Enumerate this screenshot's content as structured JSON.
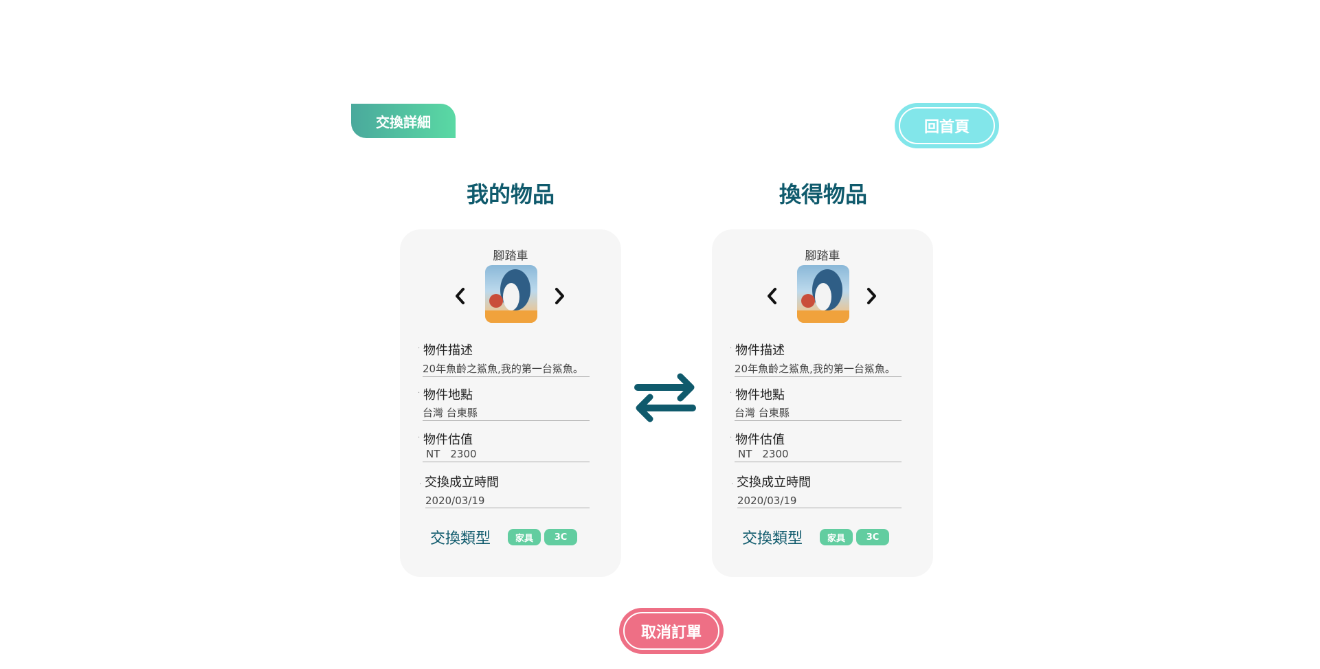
{
  "header": {
    "section_tag": "交換詳細",
    "home_button": "回首頁"
  },
  "columns": [
    {
      "title": "我的物品",
      "item_name": "腳踏車",
      "fields": {
        "description_label": "物件描述",
        "description": "20年魚齡之鯊魚,我的第一台鯊魚。",
        "location_label": "物件地點",
        "location": "台灣 台東縣",
        "value_label": "物件估值",
        "value": "NT　2300",
        "time_label": "交換成立時間",
        "time": "2020/03/19"
      },
      "type_label": "交換類型",
      "types": [
        "家具",
        "3C"
      ]
    },
    {
      "title": "換得物品",
      "item_name": "腳踏車",
      "fields": {
        "description_label": "物件描述",
        "description": "20年魚齡之鯊魚,我的第一台鯊魚。",
        "location_label": "物件地點",
        "location": "台灣 台東縣",
        "value_label": "物件估值",
        "value": "NT　2300",
        "time_label": "交換成立時間",
        "time": "2020/03/19"
      },
      "type_label": "交換類型",
      "types": [
        "家具",
        "3C"
      ]
    }
  ],
  "footer": {
    "cancel_button": "取消訂單"
  },
  "colors": {
    "primary": "#0f5a6c",
    "tag_gradient_start": "#4aa99c",
    "tag_gradient_end": "#5ad9a4",
    "home": "#82e6ea",
    "cancel": "#ee6f85",
    "chip": "#62cda0"
  },
  "icons": {
    "prev": "chevron-left-icon",
    "next": "chevron-right-icon",
    "swap": "swap-arrows-icon"
  }
}
